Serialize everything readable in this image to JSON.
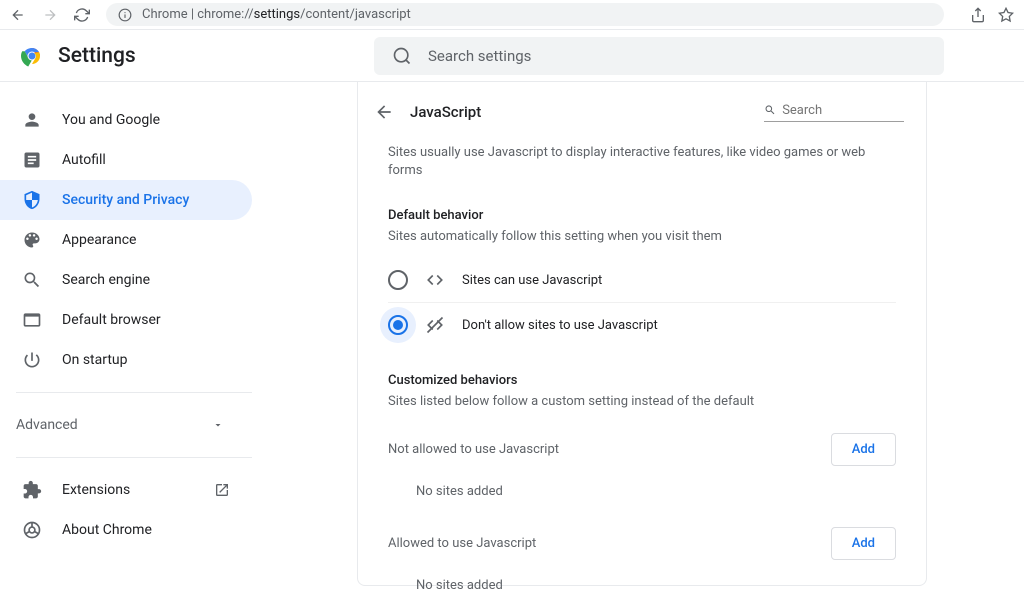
{
  "browser": {
    "url_prefix": "Chrome | ",
    "url_path_pre": "chrome://",
    "url_path_bold": "settings",
    "url_path_post": "/content/javascript"
  },
  "header": {
    "title": "Settings",
    "search_placeholder": "Search settings"
  },
  "sidebar": {
    "items": [
      {
        "label": "You and Google"
      },
      {
        "label": "Autofill"
      },
      {
        "label": "Security and Privacy"
      },
      {
        "label": "Appearance"
      },
      {
        "label": "Search engine"
      },
      {
        "label": "Default browser"
      },
      {
        "label": "On startup"
      }
    ],
    "advanced": "Advanced",
    "extensions": "Extensions",
    "about": "About Chrome"
  },
  "content": {
    "title": "JavaScript",
    "search_placeholder": "Search",
    "description": "Sites usually use Javascript to display interactive features, like video games or web forms",
    "default_behavior": {
      "title": "Default behavior",
      "sub": "Sites automatically follow this setting when you visit them",
      "opt_allow": "Sites can use Javascript",
      "opt_block": "Don't allow sites to use Javascript"
    },
    "custom": {
      "title": "Customized behaviors",
      "sub": "Sites listed below follow a custom setting instead of the default",
      "not_allowed_label": "Not allowed to use Javascript",
      "allowed_label": "Allowed to use Javascript",
      "add": "Add",
      "empty": "No sites added"
    }
  }
}
